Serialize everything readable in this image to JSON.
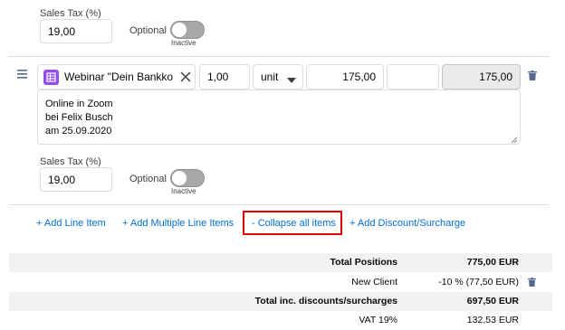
{
  "item1": {
    "tax_label": "Sales Tax (%)",
    "tax_value": "19,00",
    "optional_label": "Optional",
    "toggle_status": "Inactive"
  },
  "item2": {
    "product_name": "Webinar \"Dein Bankkonto",
    "quantity": "1,00",
    "unit": "unit",
    "price": "175,00",
    "discount": "",
    "total": "175,00",
    "description_lines": [
      "Online in Zoom",
      "bei Felix Busch",
      "am 25.09.2020"
    ],
    "tax_label": "Sales Tax (%)",
    "tax_value": "19,00",
    "optional_label": "Optional",
    "toggle_status": "Inactive"
  },
  "actions": {
    "add_line_item": "+ Add Line Item",
    "add_multiple": "+ Add Multiple Line Items",
    "collapse_all": "- Collapse all items",
    "add_discount": "+ Add Discount/Surcharge"
  },
  "totals": [
    {
      "label": "Total Positions",
      "value": "775,00 EUR",
      "bold": true,
      "shaded": true
    },
    {
      "label": "New Client",
      "value": "-10 % (77,50 EUR)",
      "bold": false,
      "shaded": false,
      "deletable": true
    },
    {
      "label": "Total inc. discounts/surcharges",
      "value": "697,50 EUR",
      "bold": true,
      "shaded": true
    },
    {
      "label": "VAT 19%",
      "value": "132,53 EUR",
      "bold": false,
      "shaded": false
    }
  ],
  "colors": {
    "link": "#0070d2",
    "highlight": "#e00000",
    "product_icon": "#9050e9"
  }
}
